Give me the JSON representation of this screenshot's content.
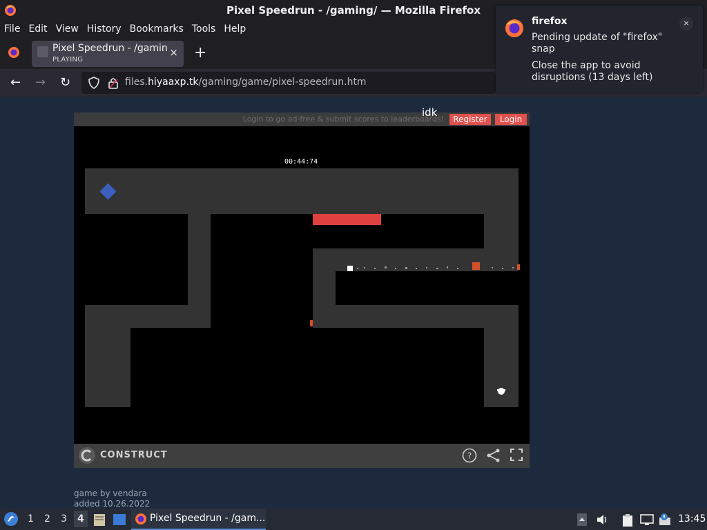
{
  "window": {
    "title": "Pixel Speedrun - /gaming/ — Mozilla Firefox"
  },
  "menu": {
    "items": [
      {
        "label": "File"
      },
      {
        "label": "Edit"
      },
      {
        "label": "View"
      },
      {
        "label": "History"
      },
      {
        "label": "Bookmarks"
      },
      {
        "label": "Tools"
      },
      {
        "label": "Help"
      }
    ]
  },
  "tab": {
    "title": "Pixel Speedrun - /gaming",
    "subtitle": "PLAYING",
    "close": "×",
    "new_tab": "+"
  },
  "nav": {
    "back_icon": "←",
    "forward_icon": "→",
    "reload_icon": "↻",
    "url_prefix": "files.",
    "url_host": "hiyaaxp.tk",
    "url_path": "/gaming/game/pixel-speedrun.htm"
  },
  "game": {
    "login_message": "Login to go ad-free & submit scores to leaderboards!",
    "register_label": "Register",
    "login_label": "Login",
    "overlay_text": "idk",
    "timer": "00:44:74",
    "engine_label": "CONSTRUCT",
    "help_icon": "?"
  },
  "credits": {
    "line1": "game by vendara",
    "line2": "added 10.26.2022"
  },
  "notification": {
    "app": "firefox",
    "title": "Pending update of \"firefox\" snap",
    "body": "Close the app to avoid disruptions (13 days left)",
    "close": "×"
  },
  "taskbar": {
    "workspaces": [
      "1",
      "2",
      "3",
      "4"
    ],
    "active_workspace": "4",
    "task_label": "Pixel Speedrun - /gam...",
    "clock": "13:45"
  },
  "colors": {
    "accent": "#e0504c",
    "floor": "#333333",
    "player": "#ffffff",
    "hazard": "#e04040",
    "diamond": "#3a5fbf"
  }
}
